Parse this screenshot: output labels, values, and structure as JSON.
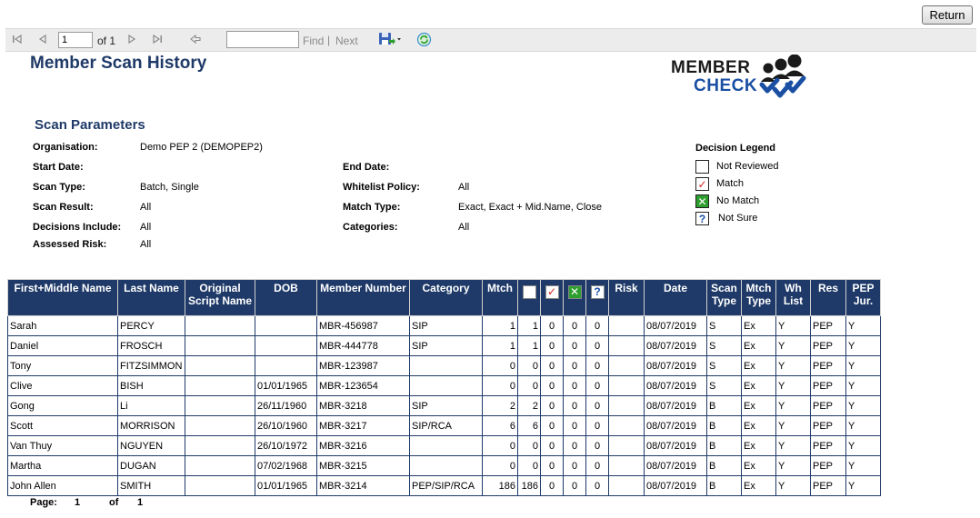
{
  "return_button": "Return",
  "toolbar": {
    "page_value": "1",
    "of_text": "of 1",
    "find_label": "Find",
    "separator": "|",
    "next_label": "Next"
  },
  "report": {
    "title": "Member Scan History",
    "logo_line1": "MEMBER",
    "logo_line2": "CHECK"
  },
  "params": {
    "heading": "Scan Parameters",
    "organisation_label": "Organisation:",
    "organisation_value": "Demo PEP 2 (DEMOPEP2)",
    "start_date_label": "Start Date:",
    "end_date_label": "End Date:",
    "scan_type_label": "Scan Type:",
    "scan_type_value": "Batch, Single",
    "whitelist_label": "Whitelist Policy:",
    "whitelist_value": "All",
    "scan_result_label": "Scan Result:",
    "scan_result_value": "All",
    "match_type_label": "Match Type:",
    "match_type_value": "Exact, Exact + Mid.Name, Close",
    "decisions_label": "Decisions Include:",
    "decisions_value": "All",
    "categories_label": "Categories:",
    "categories_value": "All",
    "assessed_risk_label": "Assessed Risk:",
    "assessed_risk_value": "All"
  },
  "legend": {
    "title": "Decision Legend",
    "not_reviewed": "Not Reviewed",
    "match": "Match",
    "no_match": "No Match",
    "not_sure": "Not Sure",
    "match_color": "#d42020",
    "no_match_color": "#2e9e2e"
  },
  "table": {
    "headers": {
      "first_name": "First+Middle Name",
      "last_name": "Last Name",
      "original_script": "Original Script Name",
      "dob": "DOB",
      "member_number": "Member Number",
      "category": "Category",
      "mtch": "Mtch",
      "risk": "Risk",
      "date": "Date",
      "scan_type": "Scan Type",
      "mtch_type": "Mtch Type",
      "wh_list": "Wh List",
      "res": "Res",
      "pep_jur": "PEP Jur."
    },
    "rows": [
      [
        "Sarah",
        "PERCY",
        "",
        "",
        "MBR-456987",
        "SIP",
        "1",
        "1",
        "0",
        "0",
        "0",
        "",
        "08/07/2019",
        "S",
        "Ex",
        "Y",
        "PEP",
        "Y"
      ],
      [
        "Daniel",
        "FROSCH",
        "",
        "",
        "MBR-444778",
        "SIP",
        "1",
        "1",
        "0",
        "0",
        "0",
        "",
        "08/07/2019",
        "S",
        "Ex",
        "Y",
        "PEP",
        "Y"
      ],
      [
        "Tony",
        "FITZSIMMON",
        "",
        "",
        "MBR-123987",
        "",
        "0",
        "0",
        "0",
        "0",
        "0",
        "",
        "08/07/2019",
        "S",
        "Ex",
        "Y",
        "PEP",
        "Y"
      ],
      [
        "Clive",
        "BISH",
        "",
        "01/01/1965",
        "MBR-123654",
        "",
        "0",
        "0",
        "0",
        "0",
        "0",
        "",
        "08/07/2019",
        "S",
        "Ex",
        "Y",
        "PEP",
        "Y"
      ],
      [
        "Gong",
        "Li",
        "",
        "26/11/1960",
        "MBR-3218",
        "SIP",
        "2",
        "2",
        "0",
        "0",
        "0",
        "",
        "08/07/2019",
        "B",
        "Ex",
        "Y",
        "PEP",
        "Y"
      ],
      [
        "Scott",
        "MORRISON",
        "",
        "26/10/1960",
        "MBR-3217",
        "SIP/RCA",
        "6",
        "6",
        "0",
        "0",
        "0",
        "",
        "08/07/2019",
        "B",
        "Ex",
        "Y",
        "PEP",
        "Y"
      ],
      [
        "Van Thuy",
        "NGUYEN",
        "",
        "26/10/1972",
        "MBR-3216",
        "",
        "0",
        "0",
        "0",
        "0",
        "0",
        "",
        "08/07/2019",
        "B",
        "Ex",
        "Y",
        "PEP",
        "Y"
      ],
      [
        "Martha",
        "DUGAN",
        "",
        "07/02/1968",
        "MBR-3215",
        "",
        "0",
        "0",
        "0",
        "0",
        "0",
        "",
        "08/07/2019",
        "B",
        "Ex",
        "Y",
        "PEP",
        "Y"
      ],
      [
        "John Allen",
        "SMITH",
        "",
        "01/01/1965",
        "MBR-3214",
        "PEP/SIP/RCA",
        "186",
        "186",
        "0",
        "0",
        "0",
        "",
        "08/07/2019",
        "B",
        "Ex",
        "Y",
        "PEP",
        "Y"
      ]
    ]
  },
  "footer": {
    "page_label": "Page:",
    "page_value": "1",
    "of_label": "of",
    "total_value": "1"
  }
}
